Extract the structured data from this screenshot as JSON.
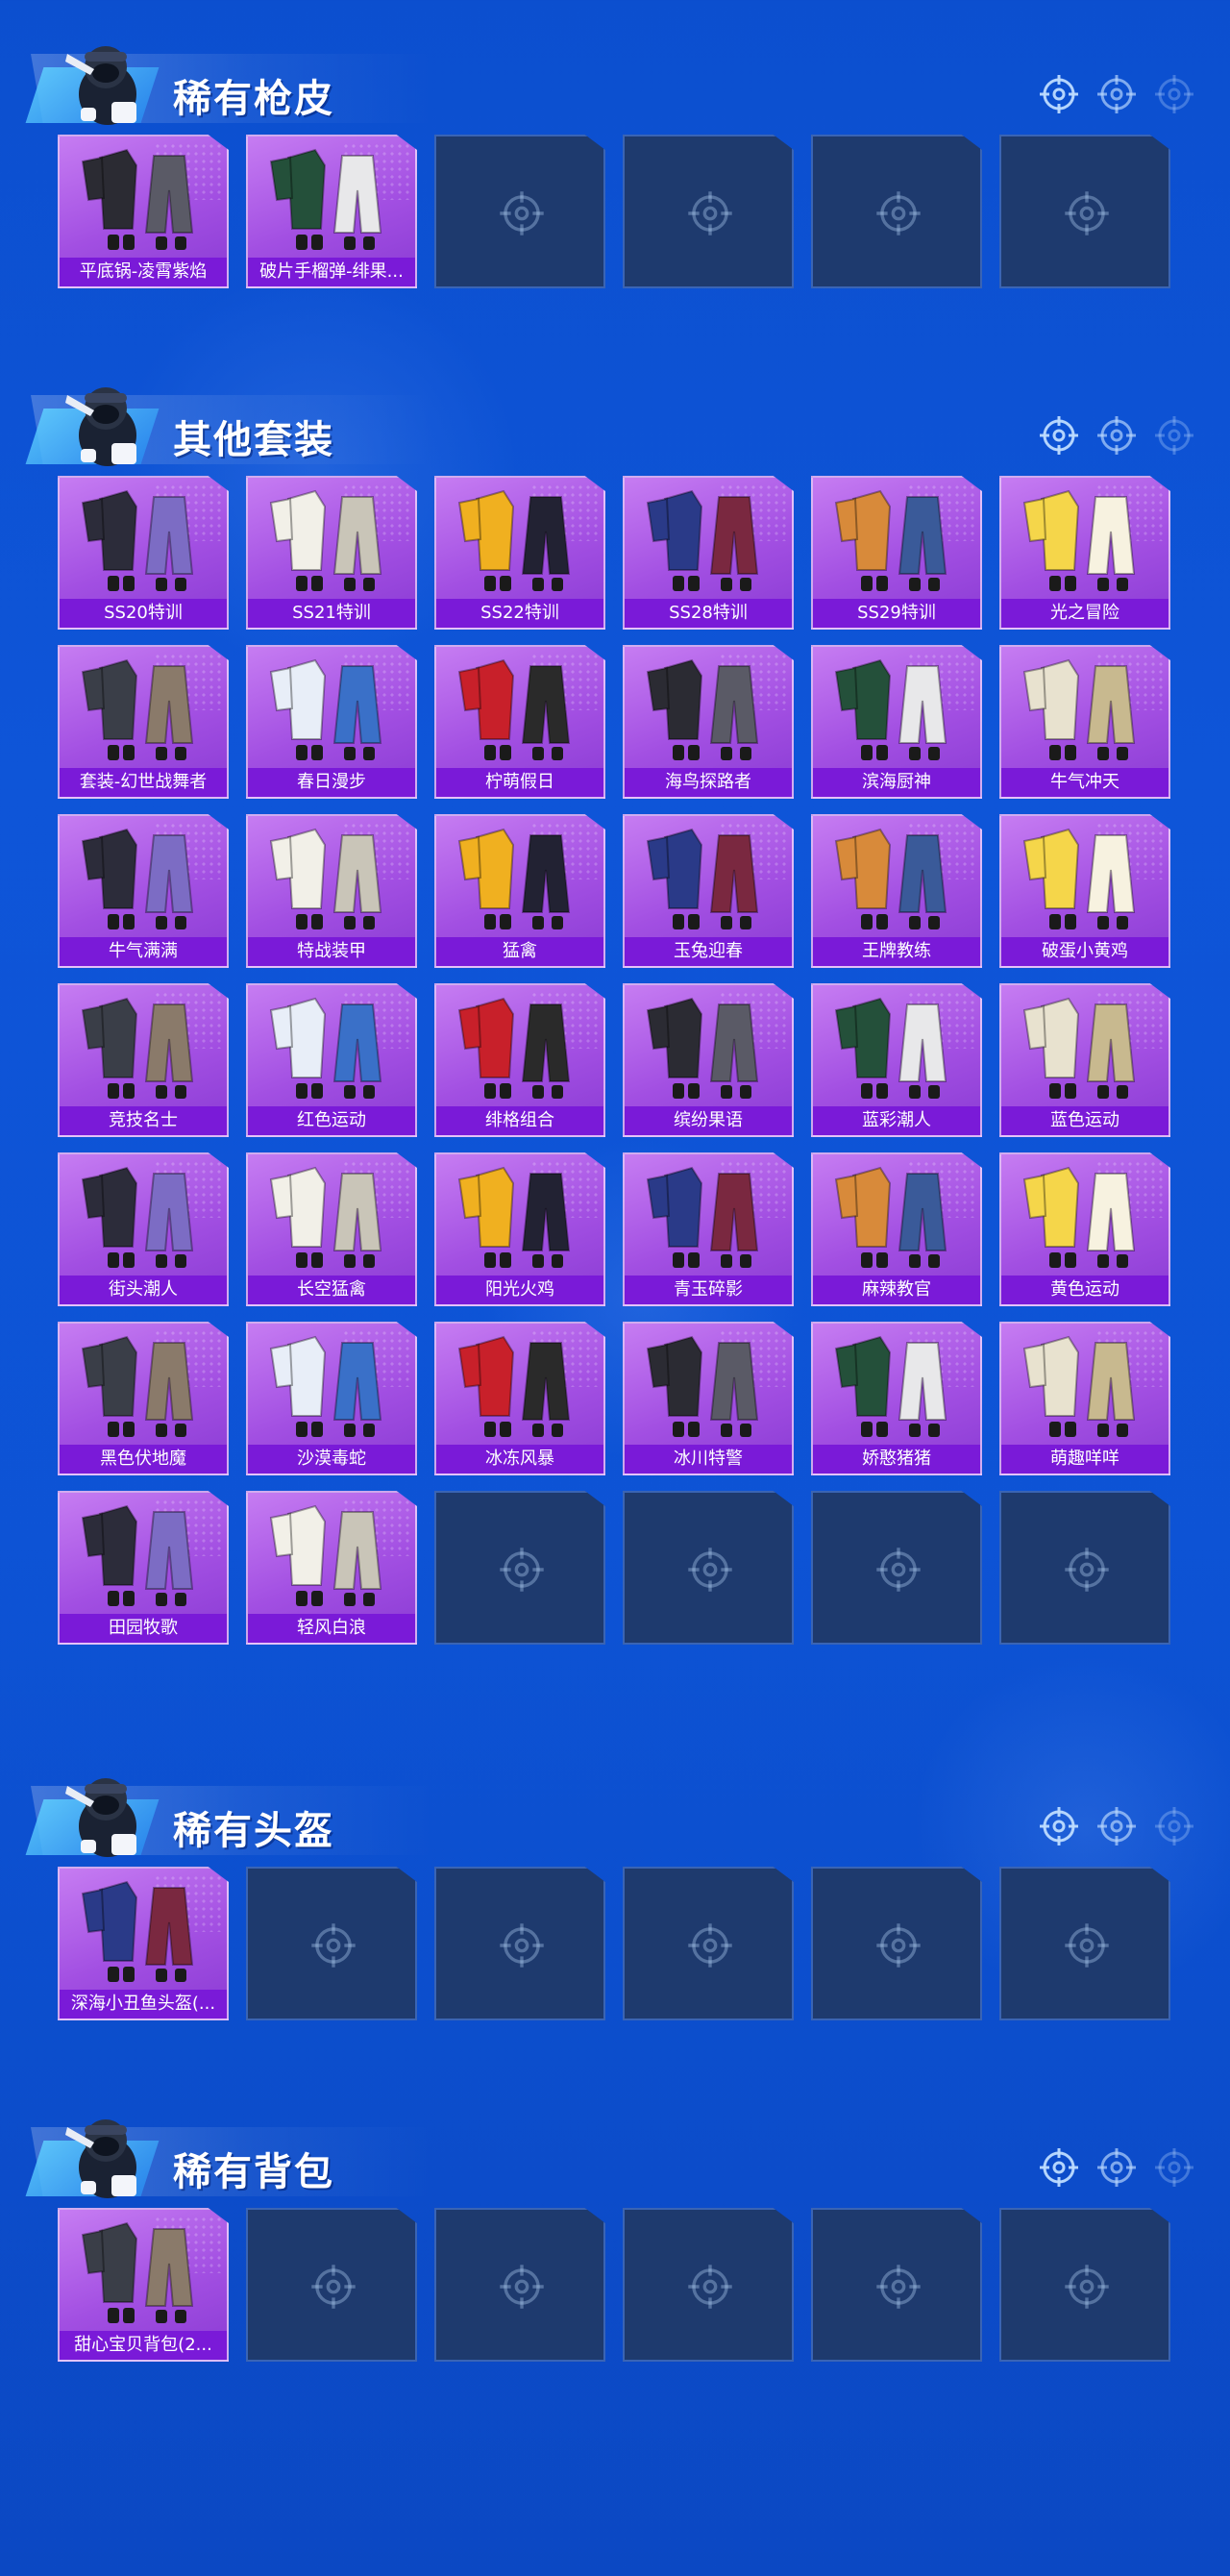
{
  "colors": {
    "background": "#0d53d5",
    "card_purple": "#a24fe2",
    "label_bar": "#7a1ad8",
    "empty_slot": "#1e3a6e"
  },
  "sections": [
    {
      "title": "稀有枪皮",
      "items": [
        "平底锅-凌霄紫焰",
        "破片手榴弹-绯果..."
      ],
      "empty_slots": 4
    },
    {
      "title": "其他套装",
      "items": [
        "SS20特训",
        "SS21特训",
        "SS22特训",
        "SS28特训",
        "SS29特训",
        "光之冒险",
        "套装-幻世战舞者",
        "春日漫步",
        "柠萌假日",
        "海鸟探路者",
        "滨海厨神",
        "牛气冲天",
        "牛气满满",
        "特战装甲",
        "猛禽",
        "玉兔迎春",
        "王牌教练",
        "破蛋小黄鸡",
        "竞技名士",
        "红色运动",
        "绯格组合",
        "缤纷果语",
        "蓝彩潮人",
        "蓝色运动",
        "街头潮人",
        "长空猛禽",
        "阳光火鸡",
        "青玉碎影",
        "麻辣教官",
        "黄色运动",
        "黑色伏地魔",
        "沙漠毒蛇",
        "冰冻风暴",
        "冰川特警",
        "娇憨猪猪",
        "萌趣咩咩",
        "田园牧歌",
        "轻风白浪"
      ],
      "empty_slots": 4
    },
    {
      "title": "稀有头盔",
      "items": [
        "深海小丑鱼头盔(..."
      ],
      "empty_slots": 5
    },
    {
      "title": "稀有背包",
      "items": [
        "甜心宝贝背包(2..."
      ],
      "empty_slots": 5
    }
  ]
}
